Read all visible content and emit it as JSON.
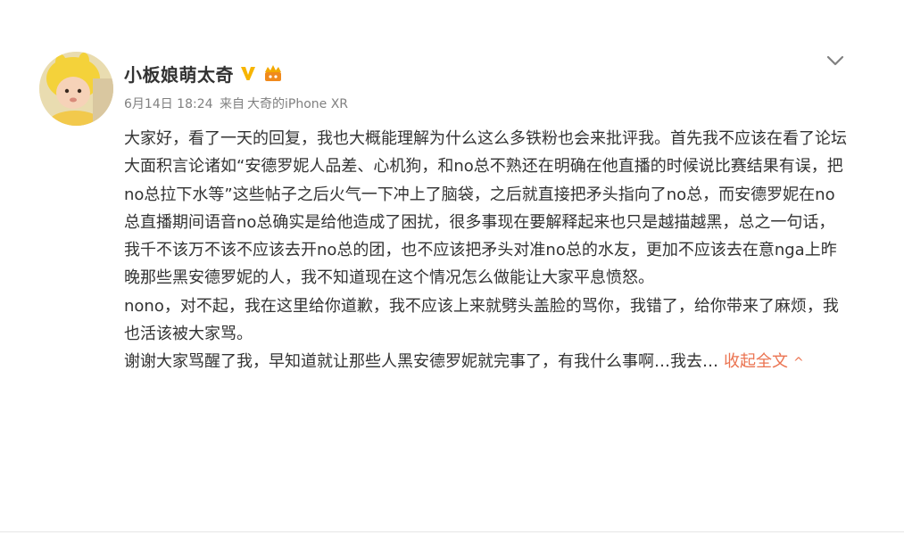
{
  "post": {
    "username": "小板娘萌太奇",
    "badges": [
      "vip-v-icon",
      "member-badge-icon"
    ],
    "date": "6月14日 18:24",
    "source_prefix": "来自",
    "source_name": "大奇的iPhone XR",
    "paragraphs": [
      "大家好，看了一天的回复，我也大概能理解为什么这么多铁粉也会来批评我。首先我不应该在看了论坛大面积言论诸如“安德罗妮人品差、心机狗，和no总不熟还在明确在他直播的时候说比赛结果有误，把no总拉下水等”这些帖子之后火气一下冲上了脑袋，之后就直接把矛头指向了no总，而安德罗妮在no总直播期间语音no总确实是给他造成了困扰，很多事现在要解释起来也只是越描越黑，总之一句话，我千不该万不该不应该去开no总的团，也不应该把矛头对准no总的水友，更加不应该去在意nga上昨晚那些黑安德罗妮的人，我不知道现在这个情况怎么做能让大家平息愤怒。",
      "nono，对不起，我在这里给你道歉，我不应该上来就劈头盖脸的骂你，我错了，给你带来了麻烦，我也活该被大家骂。",
      "谢谢大家骂醒了我，早知道就让那些人黑安德罗妮就完事了，有我什么事啊…我去…"
    ],
    "collapse_label": "收起全文",
    "collapse_caret": "^"
  },
  "colors": {
    "link": "#eb7350",
    "meta": "#808080",
    "text": "#333333",
    "vip": "#f7b500"
  }
}
